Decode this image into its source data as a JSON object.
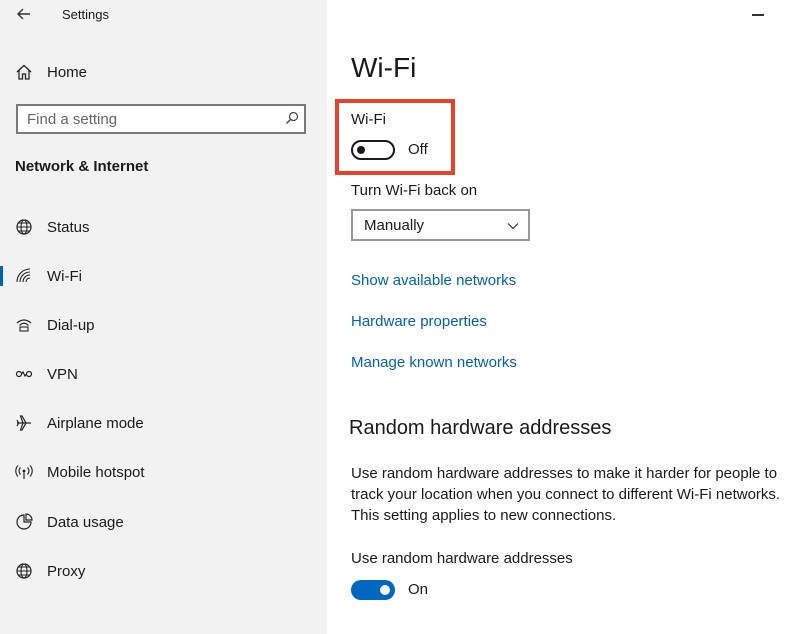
{
  "window": {
    "title": "Settings"
  },
  "sidebar": {
    "home_label": "Home",
    "search_placeholder": "Find a setting",
    "section_heading": "Network & Internet",
    "items": [
      {
        "label": "Status",
        "icon": "globe-icon"
      },
      {
        "label": "Wi-Fi",
        "icon": "wifi-icon",
        "active": true
      },
      {
        "label": "Dial-up",
        "icon": "dialup-icon"
      },
      {
        "label": "VPN",
        "icon": "vpn-icon"
      },
      {
        "label": "Airplane mode",
        "icon": "airplane-icon"
      },
      {
        "label": "Mobile hotspot",
        "icon": "hotspot-icon"
      },
      {
        "label": "Data usage",
        "icon": "data-usage-icon"
      },
      {
        "label": "Proxy",
        "icon": "globe-icon"
      }
    ]
  },
  "main": {
    "title": "Wi-Fi",
    "wifi_toggle": {
      "label": "Wi-Fi",
      "state_text": "Off",
      "on": false
    },
    "turn_back_on": {
      "label": "Turn Wi-Fi back on",
      "value": "Manually"
    },
    "links": [
      "Show available networks",
      "Hardware properties",
      "Manage known networks"
    ],
    "random_hw": {
      "heading": "Random hardware addresses",
      "description": "Use random hardware addresses to make it harder for people to track your location when you connect to different Wi-Fi networks. This setting applies to new connections.",
      "toggle_label": "Use random hardware addresses",
      "state_text": "On",
      "on": true
    }
  },
  "colors": {
    "accent": "#0063b1",
    "toggle_on": "#0067c0",
    "highlight": "#e8412c",
    "sidebar_bg": "#f2f2f2"
  }
}
